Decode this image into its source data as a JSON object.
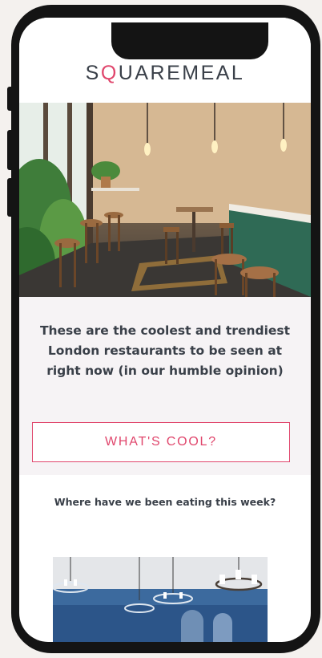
{
  "brand": {
    "logo_text_before": "S",
    "logo_text_o": "Q",
    "logo_text_after": "UAREMEAL",
    "accent_color": "#e0466c",
    "text_color": "#3a4049"
  },
  "hero": {
    "icon": "restaurant-interior-photo"
  },
  "headline": {
    "text": "These are the coolest and trendiest London restaurants to be seen at right now (in our humble opinion)"
  },
  "cta": {
    "label": "WHAT'S COOL?"
  },
  "subheading": {
    "text": "Where have we been eating this week?"
  },
  "photo2": {
    "icon": "dining-room-chandeliers-photo"
  }
}
